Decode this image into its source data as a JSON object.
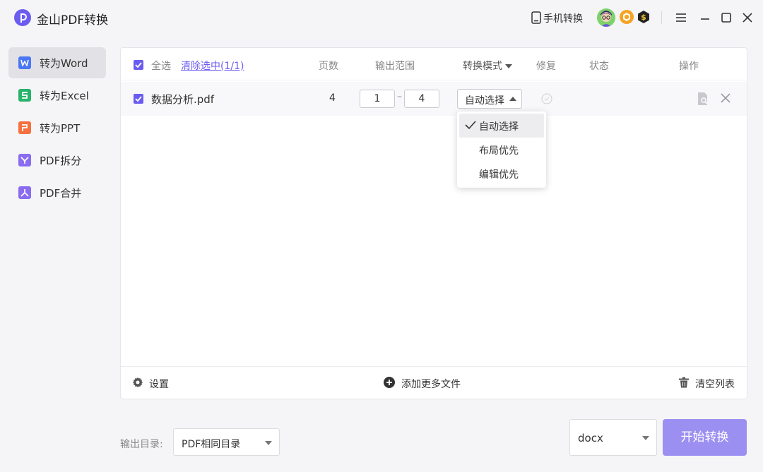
{
  "app": {
    "title": "金山PDF转换",
    "logo_icon": "pdf-logo-icon"
  },
  "header": {
    "phone_convert": "手机转换",
    "icons": [
      "phone-icon",
      "avatar",
      "hexagon-badge-icon",
      "coin-badge-icon",
      "menu-icon",
      "minimize-icon",
      "maximize-icon",
      "close-icon"
    ]
  },
  "sidebar": {
    "items": [
      {
        "label": "转为Word",
        "icon": "word-icon",
        "color": "#4a78f5",
        "active": true
      },
      {
        "label": "转为Excel",
        "icon": "excel-icon",
        "color": "#27b36a",
        "active": false
      },
      {
        "label": "转为PPT",
        "icon": "ppt-icon",
        "color": "#f57040",
        "active": false
      },
      {
        "label": "PDF拆分",
        "icon": "split-icon",
        "color": "#8a6cf0",
        "active": false
      },
      {
        "label": "PDF合并",
        "icon": "merge-icon",
        "color": "#8a6cf0",
        "active": false
      }
    ]
  },
  "table": {
    "select_all": "全选",
    "clear_selected": "清除选中(1/1)",
    "headers": {
      "pages": "页数",
      "range": "输出范围",
      "mode": "转换模式",
      "repair": "修复",
      "status": "状态",
      "actions": "操作"
    },
    "rows": [
      {
        "name": "数据分析.pdf",
        "pages": "4",
        "range_from": "1",
        "range_to": "4",
        "mode": "自动选择",
        "checked": true
      }
    ]
  },
  "mode_dropdown": {
    "options": [
      "自动选择",
      "布局优先",
      "编辑优先"
    ],
    "selected": "自动选择"
  },
  "panel_footer": {
    "settings": "设置",
    "add_more": "添加更多文件",
    "clear_list": "清空列表"
  },
  "bottom": {
    "output_dir_label": "输出目录:",
    "output_dir_value": "PDF相同目录",
    "format_value": "docx",
    "start_button": "开始转换"
  },
  "colors": {
    "accent": "#6b5cf0",
    "start_button": "#9b8ff2"
  }
}
